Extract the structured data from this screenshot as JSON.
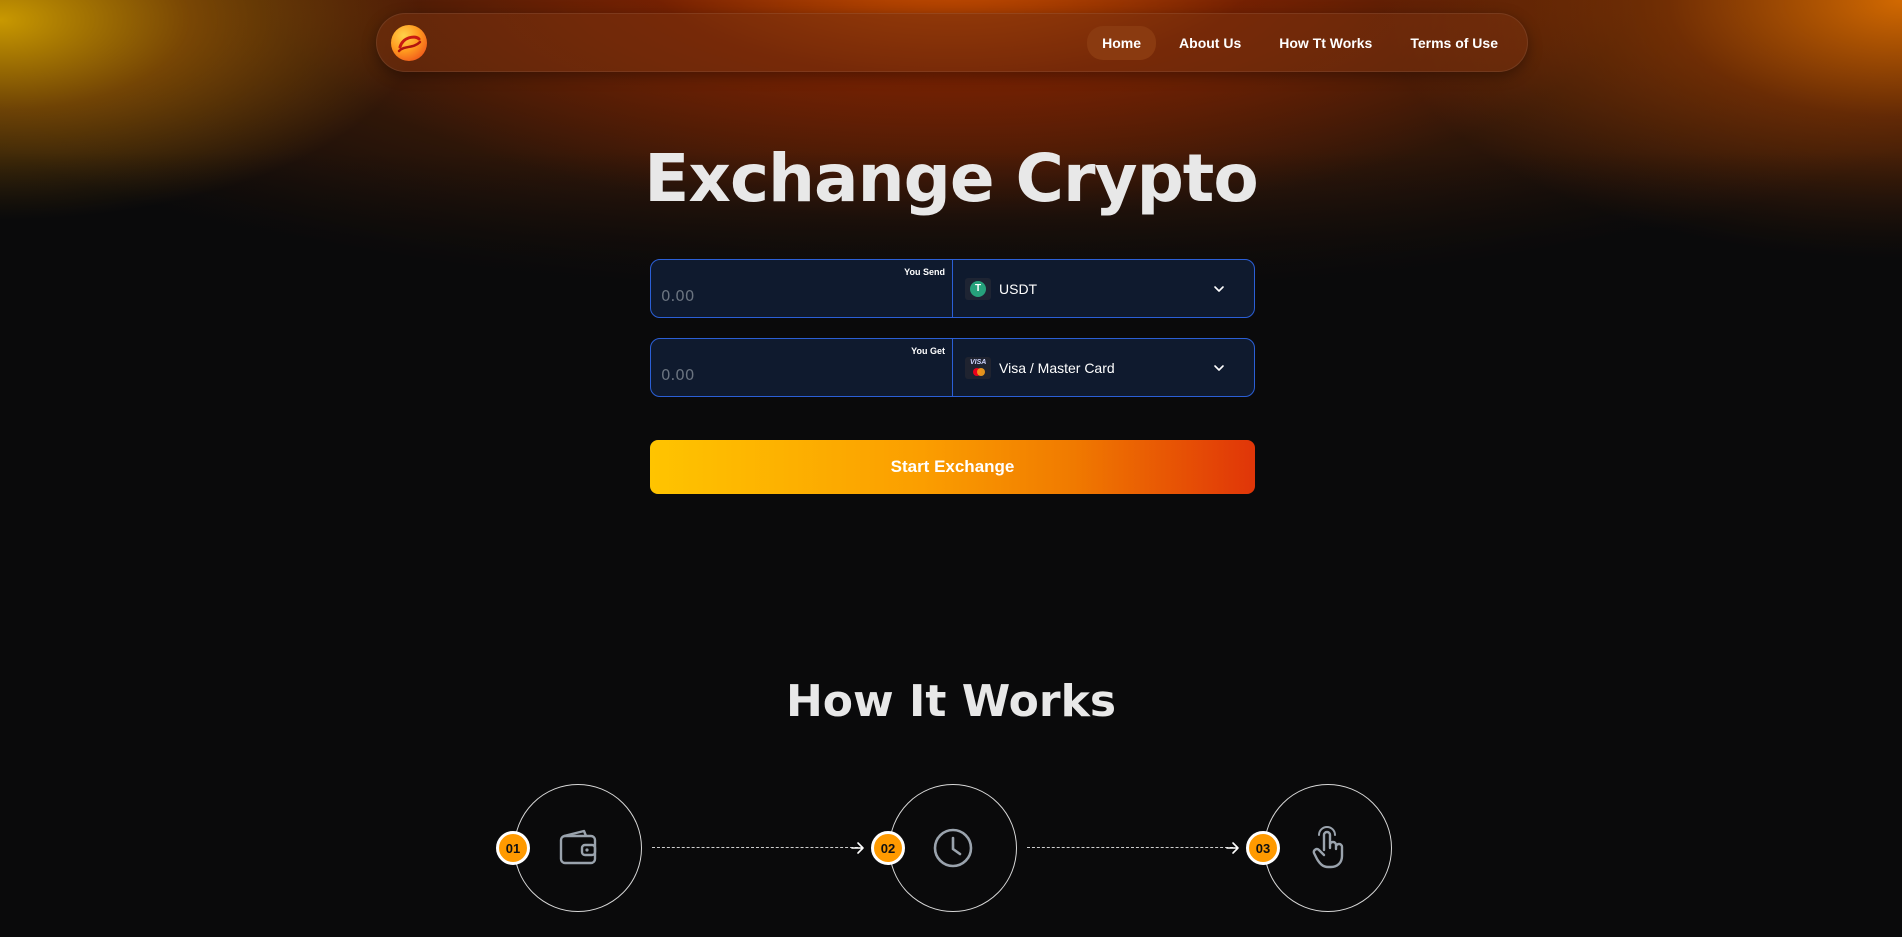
{
  "nav": {
    "logo": "logo",
    "links": [
      {
        "label": "Home",
        "active": true
      },
      {
        "label": "About Us",
        "active": false
      },
      {
        "label": "How Tt Works",
        "active": false
      },
      {
        "label": "Terms of Use",
        "active": false
      }
    ]
  },
  "hero": {
    "title": "Exchange Crypto"
  },
  "exchange": {
    "send": {
      "label": "You Send",
      "placeholder": "0.00",
      "currency": "USDT",
      "currency_icon": "tether-icon"
    },
    "get": {
      "label": "You Get",
      "placeholder": "0.00",
      "currency": "Visa / Master Card",
      "currency_icon": "visa-mastercard-icon"
    },
    "button_label": "Start Exchange"
  },
  "how_it_works": {
    "title": "How It Works",
    "steps": [
      {
        "number": "01",
        "icon": "wallet-icon"
      },
      {
        "number": "02",
        "icon": "clock-icon"
      },
      {
        "number": "03",
        "icon": "hand-pointer-icon"
      }
    ]
  },
  "colors": {
    "accent_orange": "#ff9a00",
    "button_gradient_start": "#ffc400",
    "button_gradient_end": "#e03508",
    "input_border": "#2b5fd6",
    "input_bg": "#0f1a2e",
    "page_bg": "#0a0a0b"
  }
}
